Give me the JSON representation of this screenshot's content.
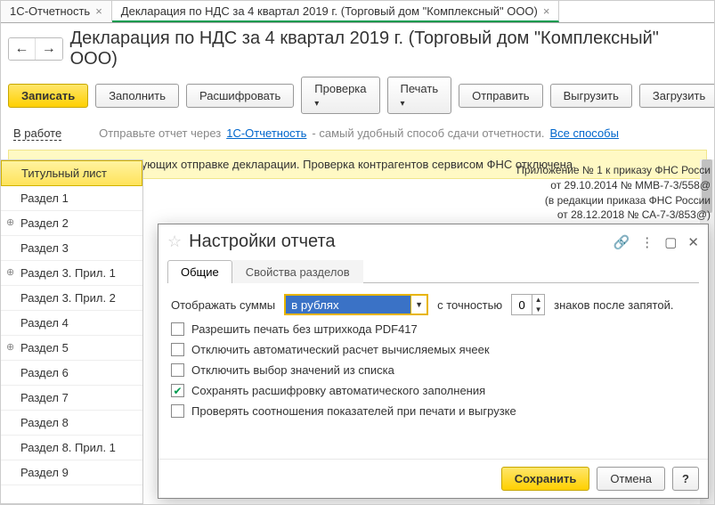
{
  "tabs": [
    {
      "label": "1С-Отчетность"
    },
    {
      "label": "Декларация по НДС за 4 квартал 2019 г. (Торговый дом \"Комплексный\" ООО)"
    }
  ],
  "title": "Декларация по НДС за 4 квартал 2019 г. (Торговый дом \"Комплексный\" ООО)",
  "toolbar": {
    "save": "Записать",
    "fill": "Заполнить",
    "decode": "Расшифровать",
    "check": "Проверка",
    "print": "Печать",
    "send": "Отправить",
    "export": "Выгрузить",
    "import": "Загрузить"
  },
  "status": {
    "label": "В работе"
  },
  "hint": {
    "pre": "Отправьте отчет через ",
    "link1": "1С-Отчетность",
    "mid": " - самый удобный способ сдачи отчетности. ",
    "link2": "Все способы"
  },
  "message": "Нет ошибок, препятствующих отправке декларации. Проверка контрагентов сервисом ФНС отключена.",
  "sidebar": [
    {
      "label": "Титульный лист",
      "selected": true
    },
    {
      "label": "Раздел 1"
    },
    {
      "label": "Раздел 2",
      "exp": true
    },
    {
      "label": "Раздел 3"
    },
    {
      "label": "Раздел 3. Прил. 1",
      "exp": true
    },
    {
      "label": "Раздел 3. Прил. 2"
    },
    {
      "label": "Раздел 4"
    },
    {
      "label": "Раздел 5",
      "exp": true
    },
    {
      "label": "Раздел 6"
    },
    {
      "label": "Раздел 7"
    },
    {
      "label": "Раздел 8"
    },
    {
      "label": "Раздел 8. Прил. 1"
    },
    {
      "label": "Раздел 9"
    }
  ],
  "attachment": {
    "l1": "Приложение № 1 к приказу ФНС Росси",
    "l2": "от 29.10.2014 № ММВ-7-3/558@",
    "l3": "(в редакции приказа ФНС России",
    "l4": "от 28.12.2018 № СА-7-3/853@)"
  },
  "modal": {
    "title": "Настройки отчета",
    "tabs": {
      "general": "Общие",
      "sections": "Свойства разделов"
    },
    "amount_label": "Отображать суммы",
    "amount_value": "в рублях",
    "precision_label": "с точностью",
    "precision_value": "0",
    "precision_after": "знаков после запятой.",
    "chk1": "Разрешить печать без штрихкода PDF417",
    "chk2": "Отключить автоматический расчет вычисляемых ячеек",
    "chk3": "Отключить выбор значений из списка",
    "chk4": "Сохранять расшифровку автоматического заполнения",
    "chk5": "Проверять соотношения показателей при печати и выгрузке",
    "save": "Сохранить",
    "cancel": "Отмена",
    "help": "?"
  }
}
